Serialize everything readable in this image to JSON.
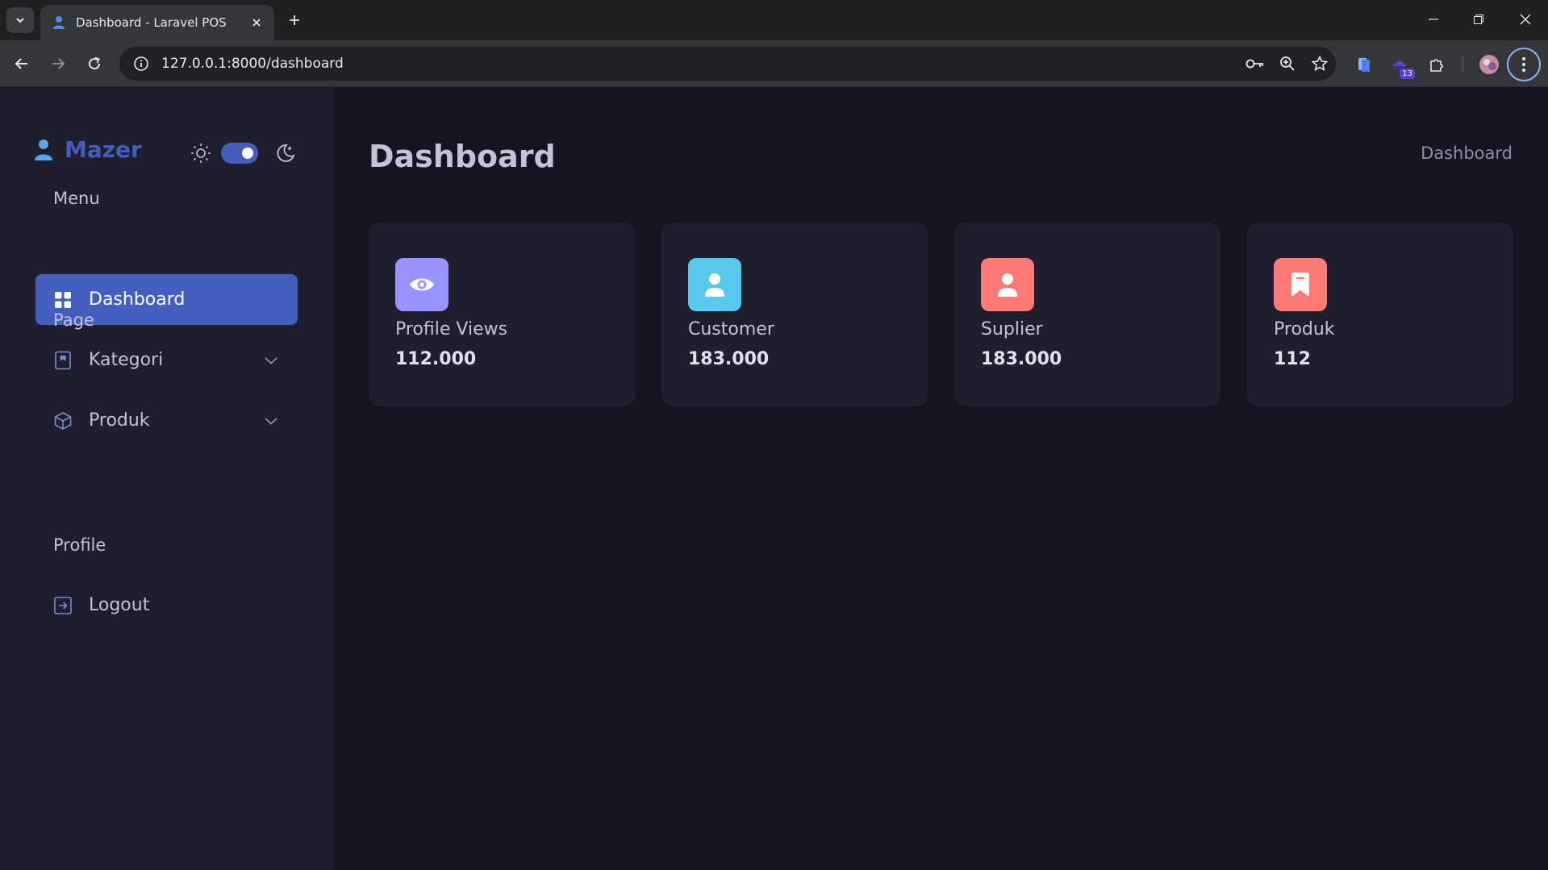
{
  "browser": {
    "tab_title": "Dashboard - Laravel POS",
    "url": "127.0.0.1:8000/dashboard",
    "extension_badge": "13"
  },
  "sidebar": {
    "brand": "Mazer",
    "sections": {
      "menu": "Menu",
      "page": "Page",
      "profile": "Profile"
    },
    "items": {
      "dashboard": "Dashboard",
      "kategori": "Kategori",
      "produk": "Produk",
      "logout": "Logout"
    }
  },
  "main": {
    "title": "Dashboard",
    "breadcrumb": "Dashboard",
    "cards": [
      {
        "label": "Profile Views",
        "value": "112.000",
        "icon": "eye-icon",
        "color": "#9694ff"
      },
      {
        "label": "Customer",
        "value": "183.000",
        "icon": "person-icon",
        "color": "#57caeb"
      },
      {
        "label": "Suplier",
        "value": "183.000",
        "icon": "person-icon",
        "color": "#ff7976"
      },
      {
        "label": "Produk",
        "value": "112",
        "icon": "bookmark-icon",
        "color": "#ff7976"
      }
    ]
  },
  "colors": {
    "accent": "#435ebe",
    "sidebar_bg": "#1e1e2d",
    "page_bg": "#151521"
  }
}
